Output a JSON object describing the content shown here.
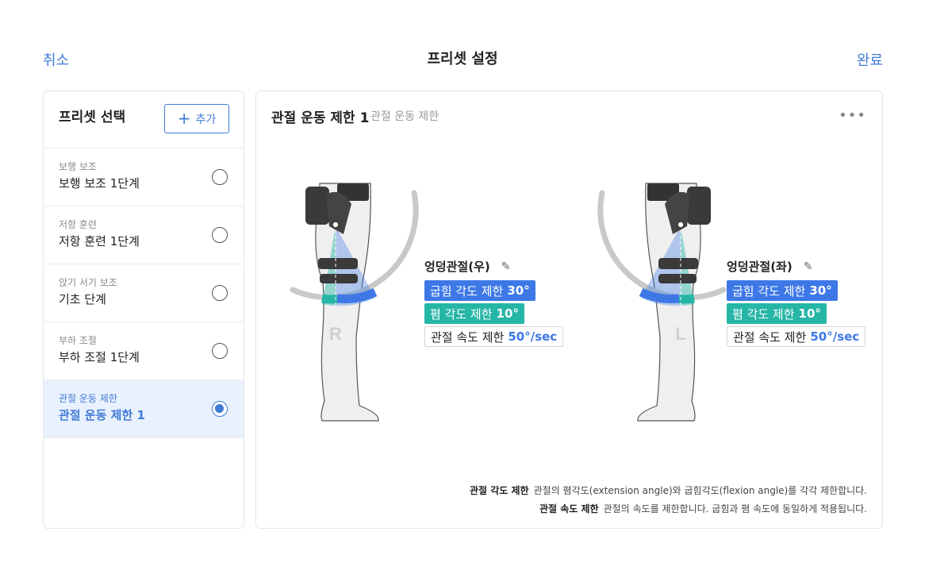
{
  "header": {
    "cancel_label": "취소",
    "title": "프리셋 설정",
    "done_label": "완료"
  },
  "preset_panel": {
    "title": "프리셋 선택",
    "add_label": "추가",
    "items": [
      {
        "category": "보행 보조",
        "name": "보행 보조 1단계",
        "selected": false
      },
      {
        "category": "저항 훈련",
        "name": "저항 훈련 1단계",
        "selected": false
      },
      {
        "category": "앉기 서기 보조",
        "name": "기초 단계",
        "selected": false
      },
      {
        "category": "부하 조절",
        "name": "부하 조절 1단계",
        "selected": false
      },
      {
        "category": "관절 운동 제한",
        "name": "관절 운동 제한 1",
        "selected": true
      }
    ]
  },
  "detail": {
    "title": "관절 운동 제한 1",
    "subtitle": "관절 운동 제한",
    "more_icon": "more-horizontal-icon",
    "right_joint": {
      "label": "엉덩관절(우)",
      "side_letter": "R",
      "flexion_label": "굽힘 각도 제한",
      "flexion_value": "30°",
      "extension_label": "폄 각도 제한",
      "extension_value": "10°",
      "speed_label": "관절 속도 제한",
      "speed_value": "50°/sec"
    },
    "left_joint": {
      "label": "엉덩관절(좌)",
      "side_letter": "L",
      "flexion_label": "굽힘 각도 제한",
      "flexion_value": "30°",
      "extension_label": "폄 각도 제한",
      "extension_value": "10°",
      "speed_label": "관절 속도 제한",
      "speed_value": "50°/sec"
    },
    "notes": [
      {
        "term": "관절 각도 제한",
        "text": "관절의 폄각도(extension angle)와 굽힘각도(flexion angle)를 각각 제한합니다."
      },
      {
        "term": "관절 속도 제한",
        "text": "관절의 속도를 제한합니다. 굽힘과 폄 속도에 동일하게 적용됩니다."
      }
    ]
  },
  "colors": {
    "accent": "#3f7ad6",
    "flexion": "#3d78e6",
    "extension": "#26b6a6",
    "selected_bg": "#e9f1fd"
  }
}
